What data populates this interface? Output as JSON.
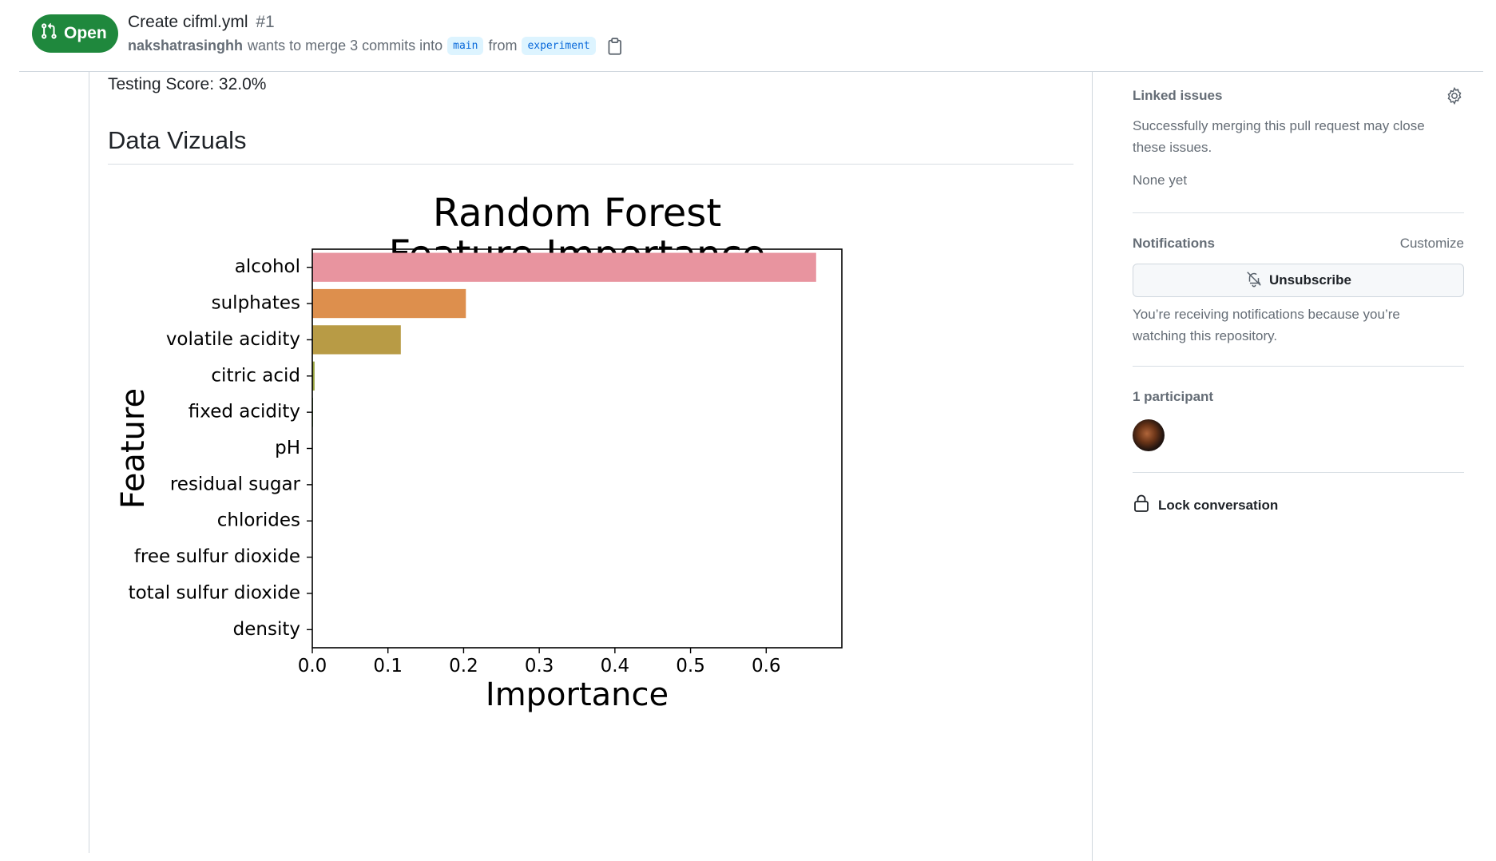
{
  "header": {
    "state_label": "Open",
    "title": "Create cifml.yml",
    "number": "#1",
    "author": "nakshatrasinghh",
    "merge_text": "wants to merge 3 commits into",
    "base_branch": "main",
    "from_text": "from",
    "head_branch": "experiment",
    "accent_color": "#1f883d"
  },
  "main": {
    "testing_score": "Testing Score: 32.0%",
    "section_heading": "Data Vizuals"
  },
  "chart_data": {
    "type": "bar",
    "orientation": "horizontal",
    "title_lines": [
      "Random Forest",
      "Feature Importance"
    ],
    "xlabel": "Importance",
    "ylabel": "Feature",
    "categories": [
      "alcohol",
      "sulphates",
      "volatile acidity",
      "citric acid",
      "fixed acidity",
      "pH",
      "residual sugar",
      "chlorides",
      "free sulfur dioxide",
      "total sulfur dioxide",
      "density"
    ],
    "values": [
      0.666,
      0.203,
      0.117,
      0.003,
      0.001,
      0,
      0,
      0,
      0,
      0,
      0
    ],
    "colors": [
      "#e8949f",
      "#dd8f4d",
      "#b89b45",
      "#97a23e",
      "#5ba04a",
      "#4aa28c",
      "#49a2ad",
      "#4d9bc9",
      "#8c93e0",
      "#c287d9",
      "#e28bbc"
    ],
    "xlim": [
      0,
      0.7
    ],
    "xticks": [
      "0.0",
      "0.1",
      "0.2",
      "0.3",
      "0.4",
      "0.5",
      "0.6"
    ],
    "grid": false,
    "legend": "none"
  },
  "sidebar": {
    "linked_issues": {
      "heading": "Linked issues",
      "description": "Successfully merging this pull request may close these issues.",
      "empty": "None yet"
    },
    "notifications": {
      "heading": "Notifications",
      "customize": "Customize",
      "button_label": "Unsubscribe",
      "description": "You’re receiving notifications because you’re watching this repository."
    },
    "participants": {
      "heading": "1 participant"
    },
    "lock": {
      "label": "Lock conversation"
    }
  }
}
